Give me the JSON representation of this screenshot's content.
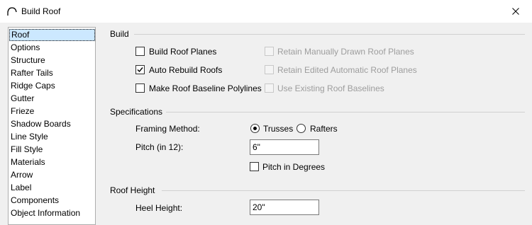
{
  "window": {
    "title": "Build Roof",
    "close_icon": "close-icon",
    "app_icon": "roof-arc-icon"
  },
  "nav": {
    "items": [
      "Roof",
      "Options",
      "Structure",
      "Rafter Tails",
      "Ridge Caps",
      "Gutter",
      "Frieze",
      "Shadow Boards",
      "Line Style",
      "Fill Style",
      "Materials",
      "Arrow",
      "Label",
      "Components",
      "Object Information"
    ],
    "selected": "Roof"
  },
  "build": {
    "heading": "Build",
    "build_roof_planes": {
      "label": "Build Roof Planes",
      "checked": false
    },
    "auto_rebuild_roofs": {
      "label": "Auto Rebuild Roofs",
      "checked": true
    },
    "make_baseline_polylines": {
      "label": "Make Roof Baseline Polylines",
      "checked": false
    },
    "retain_manual": {
      "label": "Retain Manually Drawn Roof Planes",
      "checked": false,
      "enabled": false
    },
    "retain_edited": {
      "label": "Retain Edited Automatic Roof Planes",
      "checked": false,
      "enabled": false
    },
    "use_existing": {
      "label": "Use Existing Roof Baselines",
      "checked": false,
      "enabled": false
    }
  },
  "specifications": {
    "heading": "Specifications",
    "framing_method_label": "Framing Method:",
    "trusses_label": "Trusses",
    "rafters_label": "Rafters",
    "framing_selected": "Trusses",
    "pitch_label": "Pitch (in 12):",
    "pitch_value": "6\"",
    "pitch_in_degrees": {
      "label": "Pitch in Degrees",
      "checked": false
    }
  },
  "roof_height": {
    "heading": "Roof Height",
    "heel_height_label": "Heel Height:",
    "heel_height_value": "20\""
  }
}
